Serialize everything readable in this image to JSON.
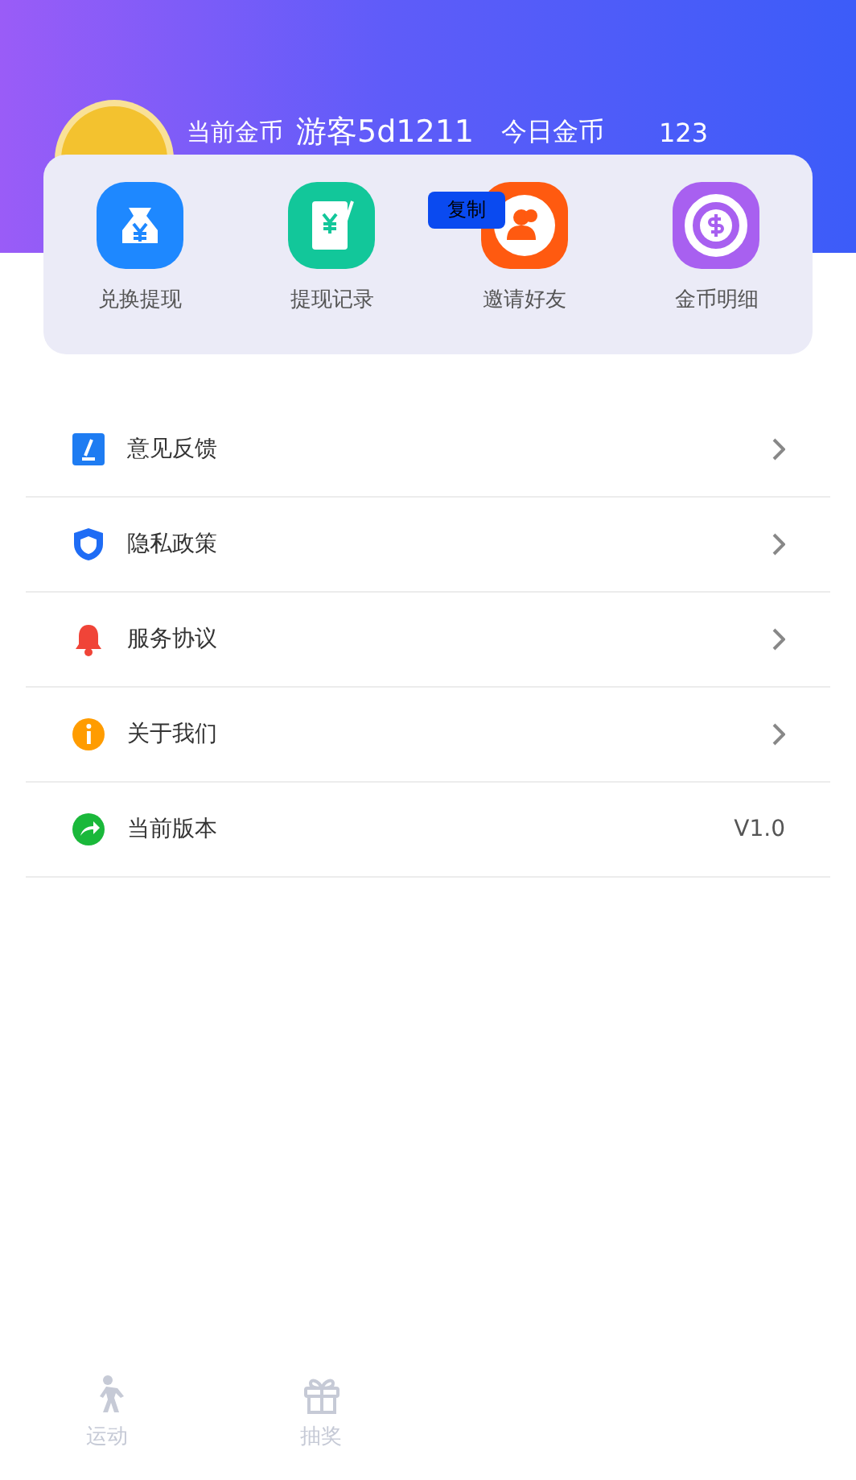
{
  "header": {
    "coins_label": "当前金币",
    "username": "游客5d1211",
    "today_label": "今日金币",
    "today_value": "123",
    "copy_button": "复制"
  },
  "shortcuts": [
    {
      "label": "兑换提现",
      "kind": "money",
      "color": "#1e88ff"
    },
    {
      "label": "提现记录",
      "kind": "record",
      "color": "#12c79a"
    },
    {
      "label": "邀请好友",
      "kind": "friends",
      "color": "#ff5a10"
    },
    {
      "label": "金币明细",
      "kind": "coin",
      "color": "#a860f0"
    }
  ],
  "menu": [
    {
      "label": "意见反馈",
      "kind": "feedback",
      "chevron": true
    },
    {
      "label": "隐私政策",
      "kind": "privacy",
      "chevron": true
    },
    {
      "label": "服务协议",
      "kind": "agreement",
      "chevron": true
    },
    {
      "label": "关于我们",
      "kind": "about",
      "chevron": true
    },
    {
      "label": "当前版本",
      "kind": "version",
      "chevron": false,
      "value": "V1.0"
    }
  ],
  "tabs": [
    {
      "label": "运动",
      "kind": "walk",
      "selected": false
    },
    {
      "label": "抽奖",
      "kind": "gift",
      "selected": false
    }
  ]
}
